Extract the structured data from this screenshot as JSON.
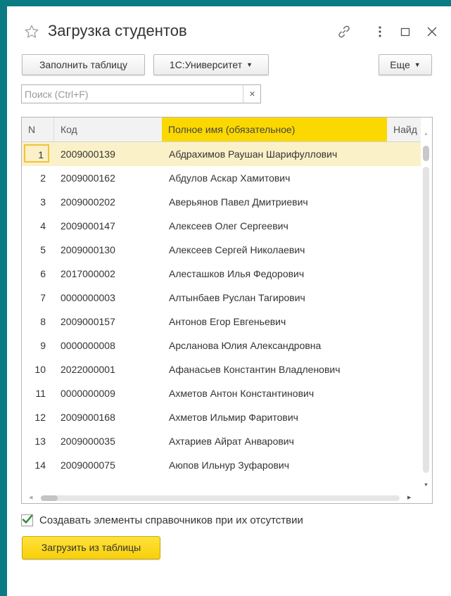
{
  "window": {
    "title": "Загрузка студентов"
  },
  "toolbar": {
    "fill_table": "Заполнить таблицу",
    "university": "1С:Университет",
    "more": "Еще"
  },
  "search": {
    "placeholder": "Поиск (Ctrl+F)",
    "value": "",
    "clear": "×"
  },
  "table": {
    "columns": [
      "N",
      "Код",
      "Полное имя (обязательное)",
      "Найд"
    ],
    "rows": [
      {
        "n": "1",
        "code": "2009000139",
        "name": "Абдрахимов Раушан Шарифуллович"
      },
      {
        "n": "2",
        "code": "2009000162",
        "name": "Абдулов Аскар Хамитович"
      },
      {
        "n": "3",
        "code": "2009000202",
        "name": "Аверьянов Павел Дмитриевич"
      },
      {
        "n": "4",
        "code": "2009000147",
        "name": "Алексеев Олег Сергеевич"
      },
      {
        "n": "5",
        "code": "2009000130",
        "name": "Алексеев Сергей Николаевич"
      },
      {
        "n": "6",
        "code": "2017000002",
        "name": "Алесташков Илья Федорович"
      },
      {
        "n": "7",
        "code": "0000000003",
        "name": "Алтынбаев Руслан Тагирович"
      },
      {
        "n": "8",
        "code": "2009000157",
        "name": "Антонов Егор Евгеньевич"
      },
      {
        "n": "9",
        "code": "0000000008",
        "name": "Арсланова Юлия Александровна"
      },
      {
        "n": "10",
        "code": "2022000001",
        "name": "Афанасьев Константин Владленович"
      },
      {
        "n": "11",
        "code": "0000000009",
        "name": "Ахметов Антон Константинович"
      },
      {
        "n": "12",
        "code": "2009000168",
        "name": "Ахметов Ильмир Фаритович"
      },
      {
        "n": "13",
        "code": "2009000035",
        "name": "Ахтариев Айрат Анварович"
      },
      {
        "n": "14",
        "code": "2009000075",
        "name": "Аюпов Ильнур Зуфарович"
      }
    ],
    "selected_row": 0
  },
  "options": {
    "create_missing_label": "Создавать элементы справочников при их отсутствии",
    "create_missing_checked": true
  },
  "actions": {
    "load_from_table": "Загрузить из таблицы"
  },
  "colors": {
    "accent_yellow": "#fbd800",
    "selected_row": "#fbf1c8",
    "check_green": "#2e8b2e",
    "frame_teal": "#0a7a83"
  },
  "icons": {
    "favorite": "star-icon",
    "link": "link-icon",
    "menu": "more-vertical-icon",
    "maximize": "maximize-icon",
    "close": "close-icon"
  }
}
